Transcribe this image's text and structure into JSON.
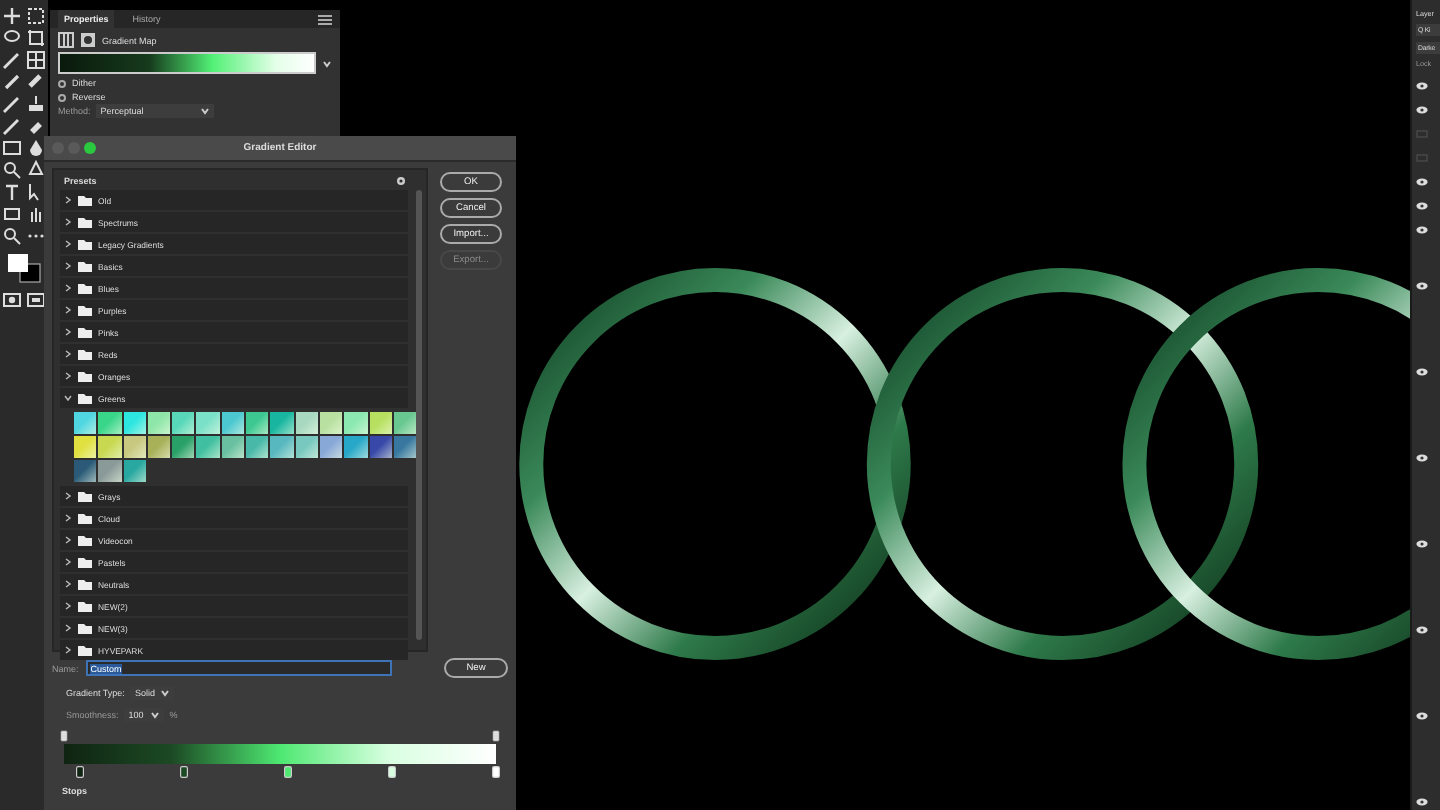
{
  "properties_panel": {
    "tabs": [
      {
        "label": "Properties",
        "selected": true
      },
      {
        "label": "History",
        "selected": false
      }
    ],
    "title": "Gradient Map",
    "options": [
      {
        "label": "Dither",
        "checked": false
      },
      {
        "label": "Reverse",
        "checked": false
      }
    ],
    "method_label": "Method:",
    "method_value": "Perceptual"
  },
  "gradient_editor": {
    "title": "Gradient Editor",
    "presets_label": "Presets",
    "folders": [
      {
        "label": "Old",
        "expanded": false
      },
      {
        "label": "Spectrums",
        "expanded": false
      },
      {
        "label": "Legacy Gradients",
        "expanded": false
      },
      {
        "label": "Basics",
        "expanded": false
      },
      {
        "label": "Blues",
        "expanded": false
      },
      {
        "label": "Purples",
        "expanded": false
      },
      {
        "label": "Pinks",
        "expanded": false
      },
      {
        "label": "Reds",
        "expanded": false
      },
      {
        "label": "Oranges",
        "expanded": false
      },
      {
        "label": "Greens",
        "expanded": true,
        "swatches": [
          {
            "color": "#4fd6e0"
          },
          {
            "color": "#39d68a"
          },
          {
            "color": "#2ee6e0"
          },
          {
            "color": "#8ee6a8"
          },
          {
            "color": "#58d8b8"
          },
          {
            "color": "#7ae0c8"
          },
          {
            "color": "#4cc8d0"
          },
          {
            "color": "#3cc890"
          },
          {
            "color": "#18b6a0"
          },
          {
            "color": "#a8d8c0"
          },
          {
            "color": "#b8e0a0"
          },
          {
            "color": "#8ae8b0"
          },
          {
            "color": "#b8e060"
          },
          {
            "color": "#68c890"
          },
          {
            "color": "#e0e040"
          },
          {
            "color": "#c8d850"
          },
          {
            "color": "#c8c880"
          },
          {
            "color": "#a8b058"
          },
          {
            "color": "#28a068"
          },
          {
            "color": "#40c0a0"
          },
          {
            "color": "#68c0a0"
          },
          {
            "color": "#48b8a8"
          },
          {
            "color": "#58b8c0"
          },
          {
            "color": "#78c8c0"
          },
          {
            "color": "#88a8d8"
          },
          {
            "color": "#28a8c8"
          },
          {
            "color": "#3848a8"
          },
          {
            "color": "#3878a0"
          },
          {
            "color": "#2a5a78"
          },
          {
            "color": "#8a9a98"
          },
          {
            "color": "#28a8a0"
          }
        ]
      },
      {
        "label": "Grays",
        "expanded": false
      },
      {
        "label": "Cloud",
        "expanded": false
      },
      {
        "label": "Videocon",
        "expanded": false
      },
      {
        "label": "Pastels",
        "expanded": false
      },
      {
        "label": "Neutrals",
        "expanded": false
      },
      {
        "label": "NEW(2)",
        "expanded": false
      },
      {
        "label": "NEW(3)",
        "expanded": false
      },
      {
        "label": "HYVEPARK",
        "expanded": false
      }
    ],
    "buttons": [
      {
        "label": "OK",
        "disabled": false
      },
      {
        "label": "Cancel",
        "disabled": false
      },
      {
        "label": "Import...",
        "disabled": false
      },
      {
        "label": "Export...",
        "disabled": true
      }
    ],
    "name_label": "Name:",
    "name_value": "Custom",
    "new_button": "New",
    "type_label": "Gradient Type:",
    "type_value": "Solid",
    "smoothness_label": "Smoothness:",
    "smoothness_value": "100",
    "smoothness_unit": "%",
    "color_stops": [
      {
        "color": "#0f2412"
      },
      {
        "color": "#1c4a24"
      },
      {
        "color": "#4ee872"
      },
      {
        "color": "#d8ffe0"
      },
      {
        "color": "#ffffff"
      }
    ],
    "stops_label": "Stops"
  },
  "layers_panel": {
    "title": "Layer",
    "search": "Q Ki",
    "blend_mode": "Darke",
    "lock_label": "Lock",
    "layers": [
      {
        "visible": true
      },
      {
        "visible": true
      },
      {
        "visible": false
      },
      {
        "visible": false
      },
      {
        "visible": true
      },
      {
        "visible": true
      },
      {
        "visible": true
      },
      {
        "visible": true
      },
      {
        "visible": true
      },
      {
        "visible": true
      },
      {
        "visible": true
      },
      {
        "visible": true
      },
      {
        "visible": true
      },
      {
        "visible": true
      }
    ]
  }
}
